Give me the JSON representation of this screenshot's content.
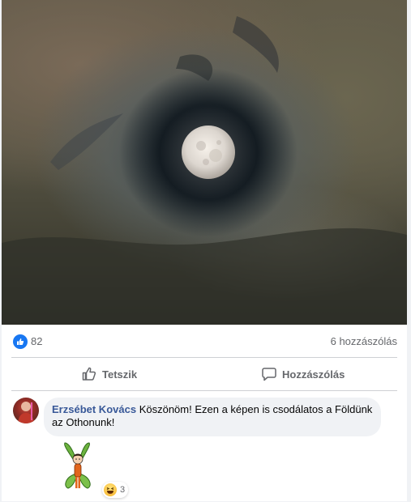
{
  "post": {
    "photo_icon": "full-moon-night-sky-photo",
    "like_count": "82",
    "comment_count": "6 hozzászólás"
  },
  "actions": {
    "like_label": "Tetszik",
    "comment_label": "Hozzászólás"
  },
  "comment": {
    "author": "Erzsébet Kovács",
    "text": "Köszönöm! Ezen a képen is csodálatos a Földünk az Othonunk!",
    "sticker_icon": "butterfly-fairy-sticker",
    "reaction_icon": "haha-emoji-icon",
    "reaction_count": "3"
  },
  "colors": {
    "accent": "#1877f2",
    "author_link": "#385898",
    "muted": "#65676b",
    "bubble": "#f0f2f5"
  }
}
